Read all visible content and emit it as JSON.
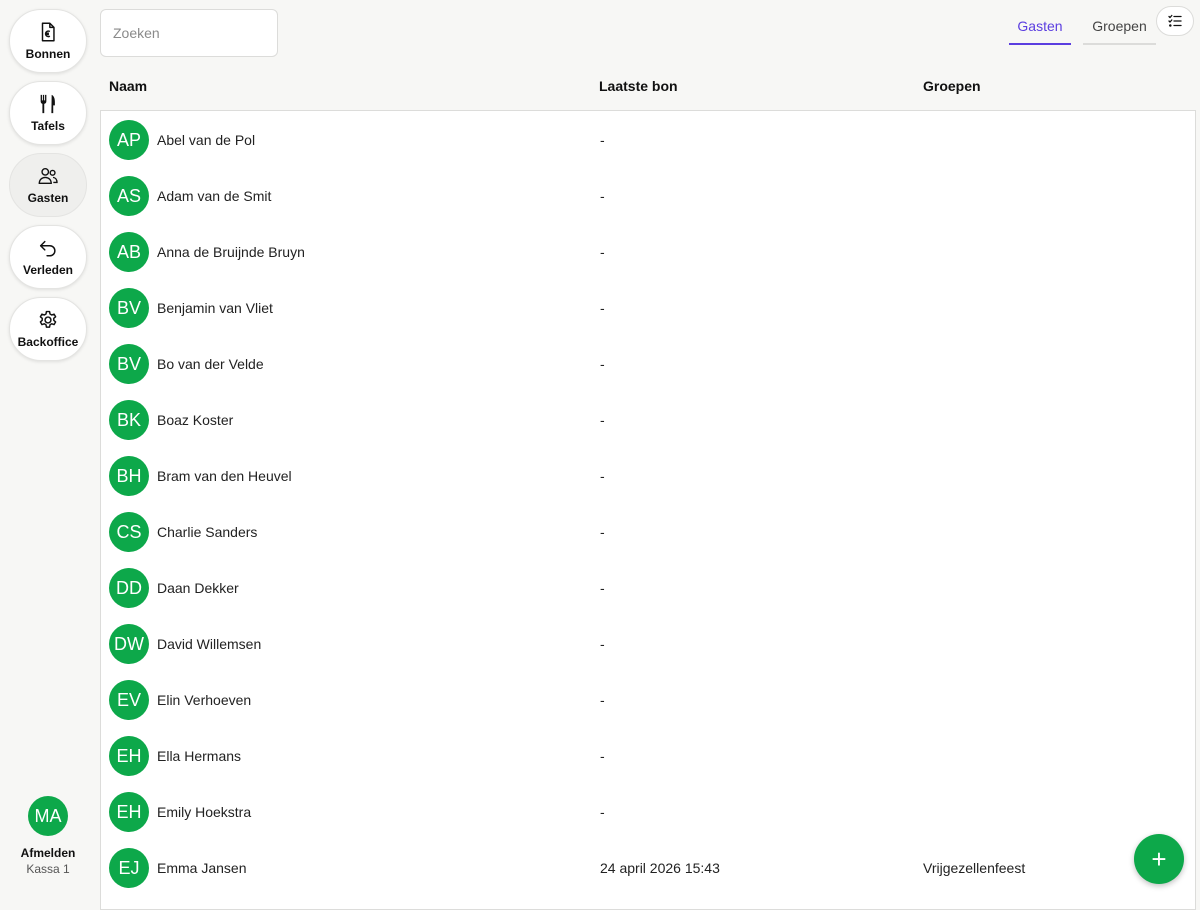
{
  "sidebar": {
    "items": [
      {
        "label": "Bonnen",
        "icon": "receipt-euro-icon",
        "active": false
      },
      {
        "label": "Tafels",
        "icon": "cutlery-icon",
        "active": false
      },
      {
        "label": "Gasten",
        "icon": "users-icon",
        "active": true
      },
      {
        "label": "Verleden",
        "icon": "undo-arrow-icon",
        "active": false
      },
      {
        "label": "Backoffice",
        "icon": "gear-icon",
        "active": false
      }
    ],
    "user": {
      "initials": "MA",
      "logout_label": "Afmelden",
      "register": "Kassa 1"
    }
  },
  "search": {
    "placeholder": "Zoeken",
    "value": ""
  },
  "tabs": [
    {
      "label": "Gasten",
      "active": true
    },
    {
      "label": "Groepen",
      "active": false
    }
  ],
  "filter_icon": "list-filter-icon",
  "table": {
    "headers": [
      "Naam",
      "Laatste bon",
      "Groepen"
    ],
    "rows": [
      {
        "initials": "AP",
        "name": "Abel van de Pol",
        "last_receipt": "-",
        "groups": ""
      },
      {
        "initials": "AS",
        "name": "Adam van de Smit",
        "last_receipt": "-",
        "groups": ""
      },
      {
        "initials": "AB",
        "name": "Anna de Bruijnde Bruyn",
        "last_receipt": "-",
        "groups": ""
      },
      {
        "initials": "BV",
        "name": "Benjamin van Vliet",
        "last_receipt": "-",
        "groups": ""
      },
      {
        "initials": "BV",
        "name": "Bo van der Velde",
        "last_receipt": "-",
        "groups": ""
      },
      {
        "initials": "BK",
        "name": "Boaz Koster",
        "last_receipt": "-",
        "groups": ""
      },
      {
        "initials": "BH",
        "name": "Bram van den Heuvel",
        "last_receipt": "-",
        "groups": ""
      },
      {
        "initials": "CS",
        "name": "Charlie Sanders",
        "last_receipt": "-",
        "groups": ""
      },
      {
        "initials": "DD",
        "name": "Daan Dekker",
        "last_receipt": "-",
        "groups": ""
      },
      {
        "initials": "DW",
        "name": "David Willemsen",
        "last_receipt": "-",
        "groups": ""
      },
      {
        "initials": "EV",
        "name": "Elin Verhoeven",
        "last_receipt": "-",
        "groups": ""
      },
      {
        "initials": "EH",
        "name": "Ella Hermans",
        "last_receipt": "-",
        "groups": ""
      },
      {
        "initials": "EH",
        "name": "Emily Hoekstra",
        "last_receipt": "-",
        "groups": ""
      },
      {
        "initials": "EJ",
        "name": "Emma Jansen",
        "last_receipt": "24 april 2026 15:43",
        "groups": "Vrijgezellenfeest"
      }
    ]
  },
  "fab": {
    "label": "+",
    "icon": "plus-icon"
  },
  "colors": {
    "accent": "#5b3ee0",
    "avatar_green": "#0da84a"
  }
}
